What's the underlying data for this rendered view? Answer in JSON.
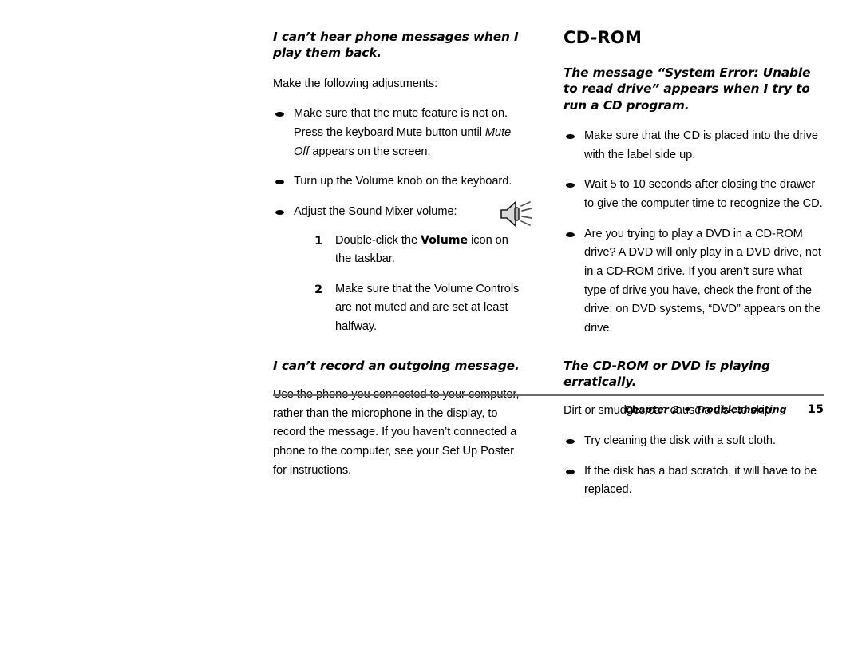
{
  "page": {
    "background_color": "#ffffff",
    "text_color": "#000000"
  },
  "left_column": {
    "heading_1": "I can’t hear phone messages when I play them back.",
    "intro_1": "Make the following adjustments:",
    "bullets": [
      {
        "pre": "Make sure that the mute feature is not on. Press the keyboard Mute button until ",
        "italic": "Mute Off",
        "post": " appears on the screen."
      },
      {
        "pre": "Turn up the Volume knob on the keyboard.",
        "italic": "",
        "post": ""
      },
      {
        "pre": "Adjust the Sound Mixer volume:",
        "italic": "",
        "post": ""
      }
    ],
    "numbered_steps": [
      {
        "number": "1",
        "pre": "Double-click the ",
        "bold": "Volume",
        "post": " icon on the taskbar."
      },
      {
        "number": "2",
        "pre": "Make sure that the Volume Controls are not muted and are set at least halfway.",
        "bold": "",
        "post": ""
      }
    ],
    "icon_name": "volume-speaker-icon",
    "heading_2": "I can’t record an outgoing message.",
    "paragraph_2": "Use the phone you connected to your computer, rather than the microphone in the display, to record the message. If you haven’t connected a phone to the computer, see your Set Up Poster for instructions."
  },
  "right_column": {
    "section_title": "CD-ROM",
    "heading_1": "The message “System Error: Unable to read drive” appears when I try to run a CD program.",
    "bullets_1": [
      "Make sure that the CD is placed into the drive with the label side up.",
      "Wait 5 to 10 seconds after closing the drawer to give the computer time to recognize the CD.",
      "Are you trying to play a DVD in a CD-ROM drive? A DVD will only play in a DVD drive, not in a CD-ROM drive. If you aren’t sure what type of drive you have, check the front of the drive; on DVD systems, “DVD” appears on the drive."
    ],
    "heading_2": "The CD-ROM or DVD is playing erratically.",
    "paragraph_2": "Dirt or smudges can cause a disk to skip.",
    "bullets_2": [
      "Try cleaning the disk with a soft cloth.",
      "If the disk has a bad scratch, it will have to be replaced."
    ]
  },
  "footer": {
    "chapter": "Chapter 2",
    "separator_icon": "bullet-dot-icon",
    "section": "Troubleshooting",
    "page_number": "15",
    "rule_color": "#6b6b6b"
  }
}
